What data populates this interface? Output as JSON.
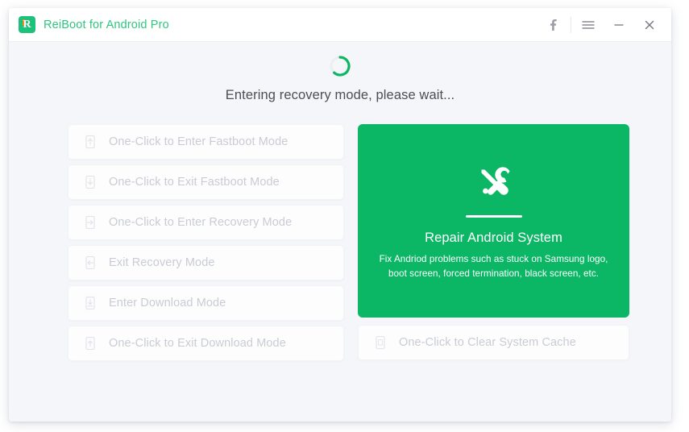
{
  "window": {
    "title": "ReiBoot for Android Pro",
    "logo_letter": "R",
    "accent_green": "#0bb765",
    "title_green": "#2ec77f",
    "logo_orange": "#f58220",
    "content_bg": "#f5f6fa"
  },
  "titlebar": {
    "facebook_label": "f",
    "menu_label": "menu",
    "minimize_label": "minimize",
    "close_label": "close"
  },
  "status": {
    "message": "Entering recovery mode, please wait...",
    "spinner": "loading-spinner"
  },
  "modes": [
    {
      "label": "One-Click to Enter Fastboot Mode",
      "icon": "phone-arrow-up-icon",
      "disabled": true
    },
    {
      "label": "One-Click to Exit Fastboot Mode",
      "icon": "phone-arrow-down-icon",
      "disabled": true
    },
    {
      "label": "One-Click to Enter Recovery Mode",
      "icon": "phone-arrow-right-icon",
      "disabled": true
    },
    {
      "label": "Exit Recovery Mode",
      "icon": "phone-arrow-left-icon",
      "disabled": true
    },
    {
      "label": "Enter Download Mode",
      "icon": "phone-download-icon",
      "disabled": true
    },
    {
      "label": "One-Click to Exit Download Mode",
      "icon": "phone-upload-icon",
      "disabled": true
    }
  ],
  "repair_card": {
    "icon": "wrench-screwdriver-icon",
    "title": "Repair Android System",
    "description": "Fix Andriod problems such as stuck on Samsung logo, boot screen, forced termination, black screen, etc."
  },
  "cache_button": {
    "label": "One-Click to Clear System Cache",
    "icon": "phone-cache-icon",
    "disabled": true
  }
}
